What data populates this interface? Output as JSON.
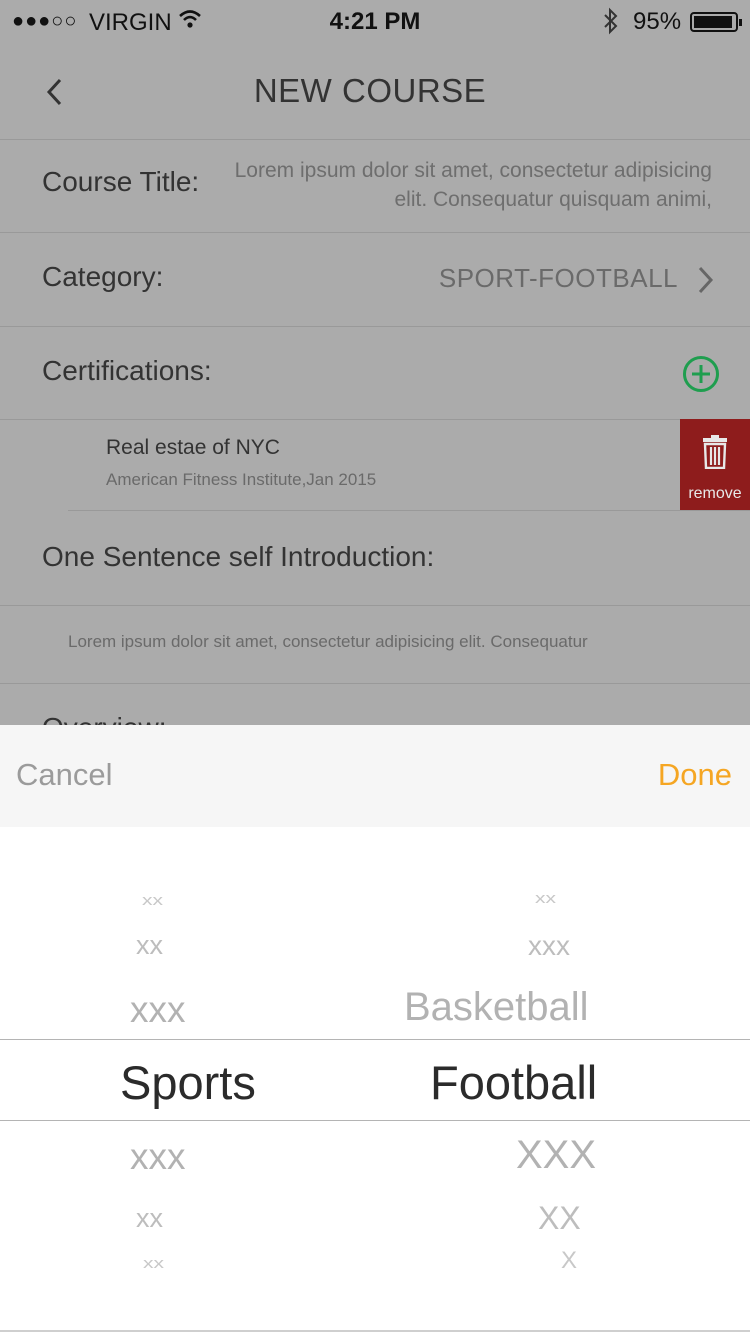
{
  "status_bar": {
    "signal": "●●●○○",
    "carrier": "VIRGIN",
    "time": "4:21 PM",
    "battery": "95%"
  },
  "nav": {
    "title": "NEW COURSE"
  },
  "form": {
    "course_title_label": "Course Title:",
    "course_title_value": "Lorem ipsum dolor sit amet, consectetur adipisicing elit. Consequatur quisquam animi,",
    "category_label": "Category:",
    "category_value": "SPORT-FOOTBALL",
    "certifications_label": "Certifications:",
    "certification": {
      "name": "Real estae of NYC",
      "detail": "American Fitness Institute,Jan 2015",
      "remove_label": "remove"
    },
    "intro_label": "One Sentence self Introduction:",
    "intro_text": "Lorem ipsum dolor sit amet, consectetur adipisicing elit. Consequatur",
    "overview_label": "Overview:"
  },
  "picker": {
    "cancel_label": "Cancel",
    "done_label": "Done",
    "left_column": {
      "above": [
        "xx",
        "xx",
        "xxx"
      ],
      "selected": "Sports",
      "below": [
        "xxx",
        "xx",
        "xx"
      ]
    },
    "right_column": {
      "above": [
        "xx",
        "xxx",
        "Basketball"
      ],
      "selected": "Football",
      "below": [
        "XXX",
        "XX",
        "X"
      ]
    }
  },
  "colors": {
    "accent_done": "#f5a623",
    "remove_bg": "#8e1c1c",
    "add_icon": "#1f9e4f"
  }
}
